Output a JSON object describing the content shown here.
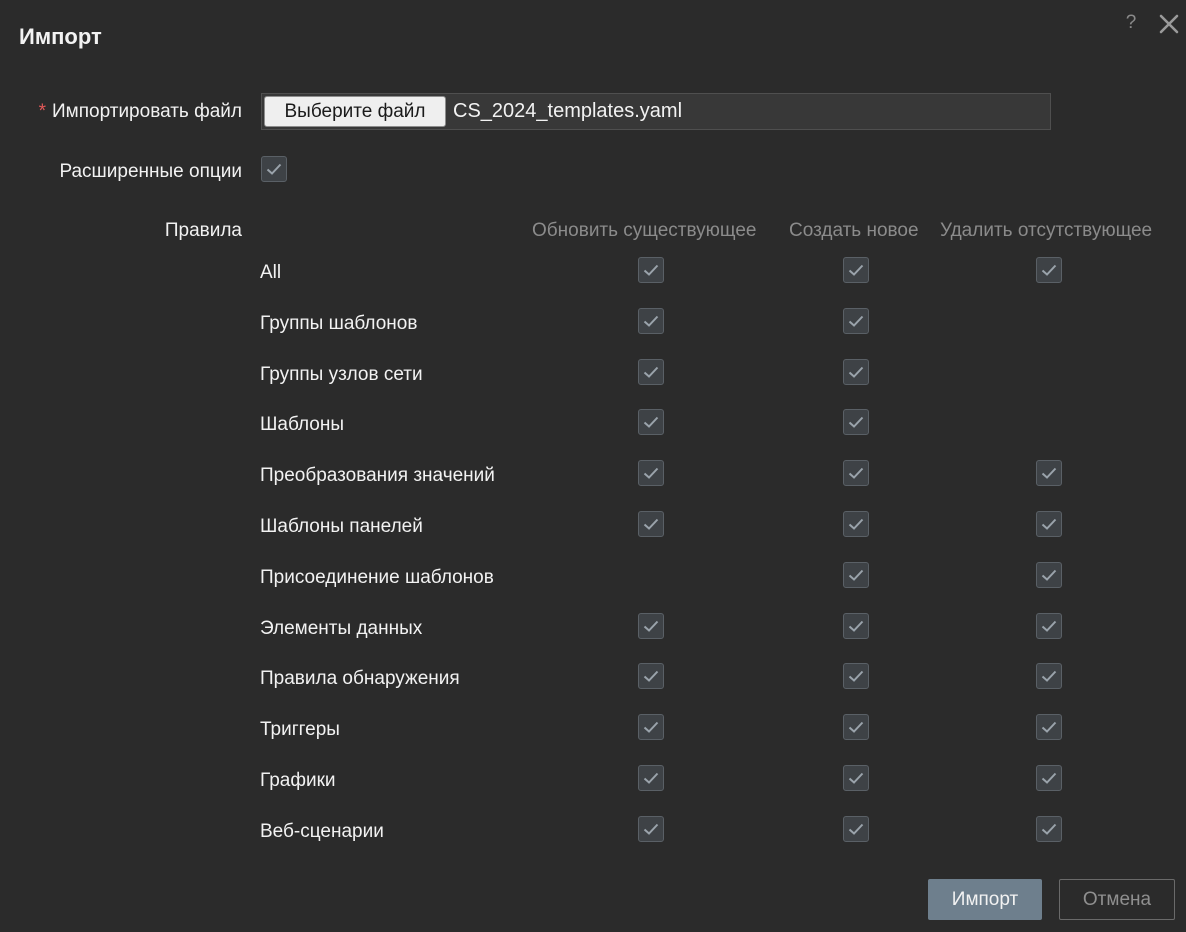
{
  "dialog": {
    "title": "Импорт",
    "help_label": "?"
  },
  "form": {
    "import_file": {
      "required_mark": "*",
      "label": "Импортировать файл",
      "button_label": "Выберите файл",
      "file_name": "CS_2024_templates.yaml"
    },
    "advanced_options": {
      "label": "Расширенные опции",
      "checked": true
    }
  },
  "rules": {
    "label": "Правила",
    "columns": [
      "Обновить существующее",
      "Создать новое",
      "Удалить отсутствующее"
    ],
    "rows": [
      {
        "label": "All",
        "update": true,
        "create": true,
        "delete": true
      },
      {
        "label": "Группы шаблонов",
        "update": true,
        "create": true,
        "delete": null
      },
      {
        "label": "Группы узлов сети",
        "update": true,
        "create": true,
        "delete": null
      },
      {
        "label": "Шаблоны",
        "update": true,
        "create": true,
        "delete": null
      },
      {
        "label": "Преобразования значений",
        "update": true,
        "create": true,
        "delete": true
      },
      {
        "label": "Шаблоны панелей",
        "update": true,
        "create": true,
        "delete": true
      },
      {
        "label": "Присоединение шаблонов",
        "update": null,
        "create": true,
        "delete": true
      },
      {
        "label": "Элементы данных",
        "update": true,
        "create": true,
        "delete": true
      },
      {
        "label": "Правила обнаружения",
        "update": true,
        "create": true,
        "delete": true
      },
      {
        "label": "Триггеры",
        "update": true,
        "create": true,
        "delete": true
      },
      {
        "label": "Графики",
        "update": true,
        "create": true,
        "delete": true
      },
      {
        "label": "Веб-сценарии",
        "update": true,
        "create": true,
        "delete": true
      }
    ]
  },
  "footer": {
    "import_label": "Импорт",
    "cancel_label": "Отмена"
  },
  "colors": {
    "background": "#2b2b2b",
    "checkbox_bg": "#3e4246",
    "checkmark": "#9aa3ab",
    "primary_button": "#6e7f8d",
    "required": "#e45959"
  }
}
